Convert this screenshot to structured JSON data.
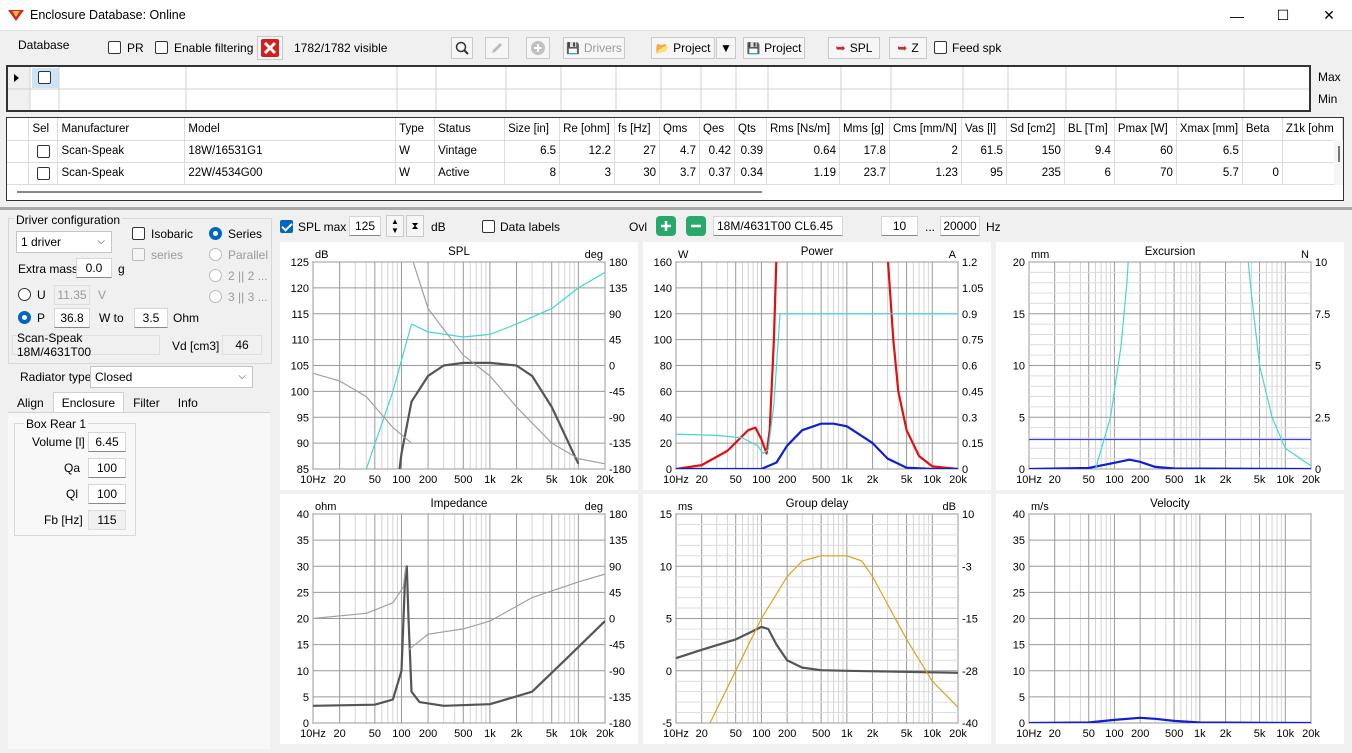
{
  "window": {
    "title": "Enclosure  Database: Online",
    "minimize": "—",
    "maximize": "☐",
    "close": "✕"
  },
  "toolbar": {
    "database_label": "Database",
    "pr_label": "PR",
    "enable_filtering_label": "Enable filtering",
    "visible_count": "1782/1782 visible",
    "drivers_label": "Drivers",
    "project_open_label": "Project",
    "project_save_label": "Project",
    "spl_label": "SPL",
    "z_label": "Z",
    "feed_spk_label": "Feed spk"
  },
  "filter_grid": {
    "max_label": "Max",
    "min_label": "Min"
  },
  "table": {
    "columns": [
      "Sel",
      "Manufacturer",
      "Model",
      "Type",
      "Status",
      "Size [in]",
      "Re [ohm]",
      "fs [Hz]",
      "Qms",
      "Qes",
      "Qts",
      "Rms [Ns/m]",
      "Mms [g]",
      "Cms [mm/N]",
      "Vas [l]",
      "Sd [cm2]",
      "BL [Tm]",
      "Pmax [W]",
      "Xmax [mm]",
      "Beta",
      "Z1k [ohm"
    ],
    "rows": [
      [
        "",
        "Scan-Speak",
        "18W/16531G1",
        "W",
        "Vintage",
        "6.5",
        "12.2",
        "27",
        "4.7",
        "0.42",
        "0.39",
        "0.64",
        "17.8",
        "2",
        "61.5",
        "150",
        "9.4",
        "60",
        "6.5",
        "",
        ""
      ],
      [
        "",
        "Scan-Speak",
        "22W/4534G00",
        "W",
        "Active",
        "8",
        "3",
        "30",
        "3.7",
        "0.37",
        "0.34",
        "1.19",
        "23.7",
        "1.23",
        "95",
        "235",
        "6",
        "70",
        "5.7",
        "0",
        ""
      ]
    ]
  },
  "driver_config": {
    "group_label": "Driver configuration",
    "count_select": "1 driver",
    "isobaric_label": "Isobaric",
    "series_label": "series",
    "series_radio": "Series",
    "parallel_radio": "Parallel",
    "opt_2": "2 || 2 ...",
    "opt_3": "3 || 3 ...",
    "extra_mass_label": "Extra mass",
    "extra_mass_value": "0.0",
    "extra_mass_unit": "g",
    "u_label": "U",
    "u_value": "11.35",
    "u_unit": "V",
    "p_label": "P",
    "p_value": "36.8",
    "w_to_label": "W to",
    "ohm_value": "3.5",
    "ohm_unit": "Ohm",
    "driver_name": "Scan-Speak 18M/4631T00",
    "vd_label": "Vd [cm3]",
    "vd_value": "46"
  },
  "radiator": {
    "label": "Radiator type",
    "value": "Closed"
  },
  "tabs": [
    "Align",
    "Enclosure",
    "Filter",
    "Info"
  ],
  "box": {
    "group_label": "Box Rear 1",
    "volume_label": "Volume [l]",
    "volume_value": "6.45",
    "qa_label": "Qa",
    "qa_value": "100",
    "ql_label": "Ql",
    "ql_value": "100",
    "fb_label": "Fb [Hz]",
    "fb_value": "115"
  },
  "chart_toolbar": {
    "spl_max_label": "SPL max",
    "spl_max_value": "125",
    "db_unit": "dB",
    "data_labels_label": "Data labels",
    "ovl_label": "Ovl",
    "overlay_name": "18M/4631T00 CL6.45",
    "f_low": "10",
    "dots": "...",
    "f_high": "20000",
    "hz_unit": "Hz"
  },
  "colors": {
    "accent": "#0067c0",
    "cyan": "#40d8d8",
    "red": "#e01010",
    "blue": "#1020d0",
    "gray": "#555555",
    "orange": "#e0a020"
  },
  "chart_data": [
    {
      "type": "line",
      "title": "SPL",
      "ylabel_left": "dB",
      "ylabel_right": "deg",
      "y_left_ticks": [
        "125",
        "120",
        "115",
        "110",
        "105",
        "100",
        "95",
        "90",
        "85"
      ],
      "y_right_ticks": [
        "180",
        "135",
        "90",
        "45",
        "0",
        "-45",
        "-90",
        "-135",
        "-180"
      ],
      "x_ticks": [
        "10Hz",
        "20",
        "50",
        "100",
        "200",
        "500",
        "1k",
        "2k",
        "5k",
        "10k",
        "20k"
      ],
      "series": [
        {
          "color": "#555555",
          "points": [
            [
              10,
              72
            ],
            [
              40,
              72
            ],
            [
              80,
              75
            ],
            [
              100,
              88
            ],
            [
              130,
              98
            ],
            [
              200,
              103
            ],
            [
              300,
              105
            ],
            [
              500,
              105.5
            ],
            [
              1000,
              105.5
            ],
            [
              2000,
              105
            ],
            [
              3000,
              103
            ],
            [
              5000,
              97
            ],
            [
              10000,
              86
            ]
          ]
        },
        {
          "color": "#40d8d8",
          "points": [
            [
              25,
              72
            ],
            [
              40,
              85
            ],
            [
              80,
              100
            ],
            [
              130,
              113
            ],
            [
              200,
              111.5
            ],
            [
              500,
              110.5
            ],
            [
              1000,
              111
            ],
            [
              2000,
              113
            ],
            [
              5000,
              116
            ],
            [
              10000,
              120
            ],
            [
              20000,
              123
            ]
          ]
        },
        {
          "color": "#a0a0a0",
          "points": [
            [
              10,
              103.5
            ],
            [
              20,
              102
            ],
            [
              40,
              99
            ],
            [
              80,
              93
            ],
            [
              130,
              90
            ]
          ]
        },
        {
          "color": "#a0a0a0",
          "points": [
            [
              130,
              126
            ],
            [
              200,
              116
            ],
            [
              500,
              107
            ],
            [
              1000,
              103
            ],
            [
              2000,
              97
            ],
            [
              5000,
              90
            ],
            [
              10000,
              87
            ],
            [
              20000,
              86
            ]
          ]
        }
      ]
    },
    {
      "type": "line",
      "title": "Power",
      "ylabel_left": "W",
      "ylabel_right": "A",
      "y_left_ticks": [
        "160",
        "140",
        "120",
        "100",
        "80",
        "60",
        "40",
        "20",
        "0"
      ],
      "y_right_ticks": [
        "1.2",
        "1.05",
        "0.9",
        "0.75",
        "0.6",
        "0.45",
        "0.3",
        "0.15",
        "0"
      ],
      "x_ticks": [
        "10Hz",
        "20",
        "50",
        "100",
        "200",
        "500",
        "1k",
        "2k",
        "5k",
        "10k",
        "20k"
      ],
      "series": [
        {
          "color": "#e01010",
          "points": [
            [
              10,
              0
            ],
            [
              20,
              3
            ],
            [
              40,
              14
            ],
            [
              70,
              30
            ],
            [
              85,
              32
            ],
            [
              100,
              23
            ],
            [
              115,
              12
            ],
            [
              125,
              30
            ],
            [
              140,
              100
            ],
            [
              150,
              165
            ]
          ]
        },
        {
          "color": "#e01010",
          "points": [
            [
              3000,
              165
            ],
            [
              3500,
              100
            ],
            [
              4000,
              60
            ],
            [
              5000,
              30
            ],
            [
              7000,
              10
            ],
            [
              10000,
              2
            ],
            [
              20000,
              0
            ]
          ]
        },
        {
          "color": "#40d8d8",
          "points": [
            [
              10,
              27
            ],
            [
              30,
              26
            ],
            [
              60,
              24
            ],
            [
              90,
              18
            ],
            [
              105,
              12
            ],
            [
              120,
              15
            ],
            [
              140,
              50
            ],
            [
              165,
              120
            ],
            [
              20000,
              120
            ]
          ]
        },
        {
          "color": "#1020d0",
          "points": [
            [
              10,
              0
            ],
            [
              100,
              0
            ],
            [
              150,
              5
            ],
            [
              200,
              18
            ],
            [
              300,
              30
            ],
            [
              500,
              35
            ],
            [
              700,
              35
            ],
            [
              1000,
              33
            ],
            [
              2000,
              20
            ],
            [
              3000,
              8
            ],
            [
              5000,
              1
            ],
            [
              10000,
              0
            ],
            [
              20000,
              0
            ]
          ]
        }
      ]
    },
    {
      "type": "line",
      "title": "Excursion",
      "ylabel_left": "mm",
      "ylabel_right": "N",
      "y_left_ticks": [
        "20",
        "15",
        "10",
        "5",
        "0"
      ],
      "y_right_ticks": [
        "10",
        "7.5",
        "5",
        "2.5",
        "0"
      ],
      "x_ticks": [
        "10Hz",
        "20",
        "50",
        "100",
        "200",
        "500",
        "1k",
        "2k",
        "5k",
        "10k",
        "20k"
      ],
      "series": [
        {
          "color": "#1020d0",
          "points": [
            [
              10,
              0
            ],
            [
              50,
              0.1
            ],
            [
              100,
              0.6
            ],
            [
              150,
              0.9
            ],
            [
              200,
              0.7
            ],
            [
              300,
              0.2
            ],
            [
              500,
              0.05
            ],
            [
              20000,
              0
            ]
          ]
        },
        {
          "color": "#4040e0",
          "points": [
            [
              10,
              2.85
            ],
            [
              20000,
              2.85
            ]
          ]
        },
        {
          "color": "#40d8d8",
          "points": [
            [
              60,
              0
            ],
            [
              90,
              5
            ],
            [
              120,
              12
            ],
            [
              140,
              18
            ],
            [
              150,
              22
            ]
          ]
        },
        {
          "color": "#40d8d8",
          "points": [
            [
              3500,
              22
            ],
            [
              4000,
              17
            ],
            [
              5000,
              10
            ],
            [
              7000,
              5
            ],
            [
              10000,
              2
            ],
            [
              20000,
              0.3
            ]
          ]
        }
      ]
    },
    {
      "type": "line",
      "title": "Impedance",
      "ylabel_left": "ohm",
      "ylabel_right": "deg",
      "y_left_ticks": [
        "40",
        "35",
        "30",
        "25",
        "20",
        "15",
        "10",
        "5",
        "0"
      ],
      "y_right_ticks": [
        "180",
        "135",
        "90",
        "45",
        "0",
        "-45",
        "-90",
        "-135",
        "-180"
      ],
      "x_ticks": [
        "10Hz",
        "20",
        "50",
        "100",
        "200",
        "500",
        "1k",
        "2k",
        "5k",
        "10k",
        "20k"
      ],
      "series": [
        {
          "color": "#555555",
          "points": [
            [
              10,
              3.3
            ],
            [
              50,
              3.5
            ],
            [
              80,
              4.5
            ],
            [
              100,
              10
            ],
            [
              110,
              28
            ],
            [
              115,
              30
            ],
            [
              120,
              20
            ],
            [
              130,
              6
            ],
            [
              160,
              4
            ],
            [
              300,
              3.3
            ],
            [
              1000,
              3.6
            ],
            [
              3000,
              6
            ],
            [
              7000,
              12
            ],
            [
              20000,
              19.5
            ]
          ]
        },
        {
          "color": "#a0a0a0",
          "points": [
            [
              10,
              20
            ],
            [
              40,
              21
            ],
            [
              80,
              23
            ],
            [
              105,
              26
            ],
            [
              112,
              30
            ]
          ]
        },
        {
          "color": "#a0a0a0",
          "points": [
            [
              120,
              14
            ],
            [
              200,
              17
            ],
            [
              500,
              18
            ],
            [
              1000,
              19.5
            ],
            [
              3000,
              24
            ],
            [
              10000,
              27
            ],
            [
              20000,
              28.5
            ]
          ]
        }
      ]
    },
    {
      "type": "line",
      "title": "Group delay",
      "ylabel_left": "ms",
      "ylabel_right": "dB",
      "y_left_ticks": [
        "15",
        "10",
        "5",
        "0",
        "-5"
      ],
      "y_right_ticks": [
        "10",
        "-3",
        "-15",
        "-28",
        "-40"
      ],
      "x_ticks": [
        "10Hz",
        "20",
        "50",
        "100",
        "200",
        "500",
        "1k",
        "2k",
        "5k",
        "10k",
        "20k"
      ],
      "series": [
        {
          "color": "#555555",
          "points": [
            [
              10,
              1.2
            ],
            [
              20,
              2
            ],
            [
              50,
              3
            ],
            [
              80,
              3.8
            ],
            [
              100,
              4.2
            ],
            [
              120,
              4
            ],
            [
              150,
              2.5
            ],
            [
              200,
              1
            ],
            [
              300,
              0.3
            ],
            [
              500,
              0.05
            ],
            [
              1000,
              0
            ],
            [
              20000,
              -0.2
            ]
          ]
        },
        {
          "color": "#e0a020",
          "points": [
            [
              25,
              -5
            ],
            [
              50,
              0
            ],
            [
              100,
              5
            ],
            [
              200,
              9
            ],
            [
              300,
              10.5
            ],
            [
              500,
              11
            ],
            [
              1000,
              11
            ],
            [
              1500,
              10.5
            ],
            [
              2000,
              9
            ],
            [
              5000,
              3
            ],
            [
              10000,
              -1
            ],
            [
              20000,
              -3.5
            ]
          ]
        }
      ]
    },
    {
      "type": "line",
      "title": "Velocity",
      "ylabel_left": "m/s",
      "y_left_ticks": [
        "40",
        "35",
        "30",
        "25",
        "20",
        "15",
        "10",
        "5",
        "0"
      ],
      "x_ticks": [
        "10Hz",
        "20",
        "50",
        "100",
        "200",
        "500",
        "1k",
        "2k",
        "5k",
        "10k",
        "20k"
      ],
      "series": [
        {
          "color": "#1020d0",
          "points": [
            [
              10,
              0
            ],
            [
              50,
              0.1
            ],
            [
              100,
              0.6
            ],
            [
              200,
              1
            ],
            [
              300,
              0.8
            ],
            [
              500,
              0.4
            ],
            [
              1000,
              0.1
            ],
            [
              20000,
              0
            ]
          ]
        }
      ]
    }
  ]
}
